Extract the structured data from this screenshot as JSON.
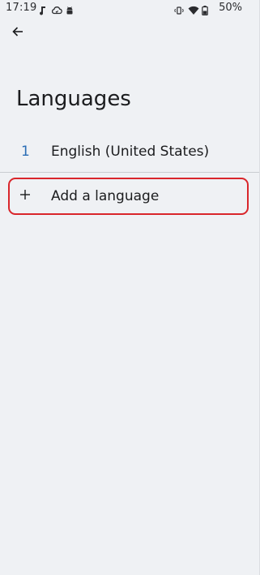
{
  "status_bar": {
    "time": "17:19",
    "battery": "50%",
    "left_icons": [
      "music-note-icon",
      "cloud-sync-icon",
      "android-icon"
    ],
    "right_icons": [
      "vibrate-icon",
      "wifi-icon",
      "battery-icon"
    ]
  },
  "app_bar": {
    "back_icon": "arrow-left-icon"
  },
  "page": {
    "title": "Languages"
  },
  "languages": [
    {
      "index": "1",
      "name": "English (United States)"
    }
  ],
  "add_language": {
    "icon": "plus-icon",
    "label": "Add a language",
    "highlight_color": "#d9262b"
  },
  "colors": {
    "background": "#eff1f4",
    "accent": "#2a6db5",
    "text": "#1b1c1e"
  }
}
